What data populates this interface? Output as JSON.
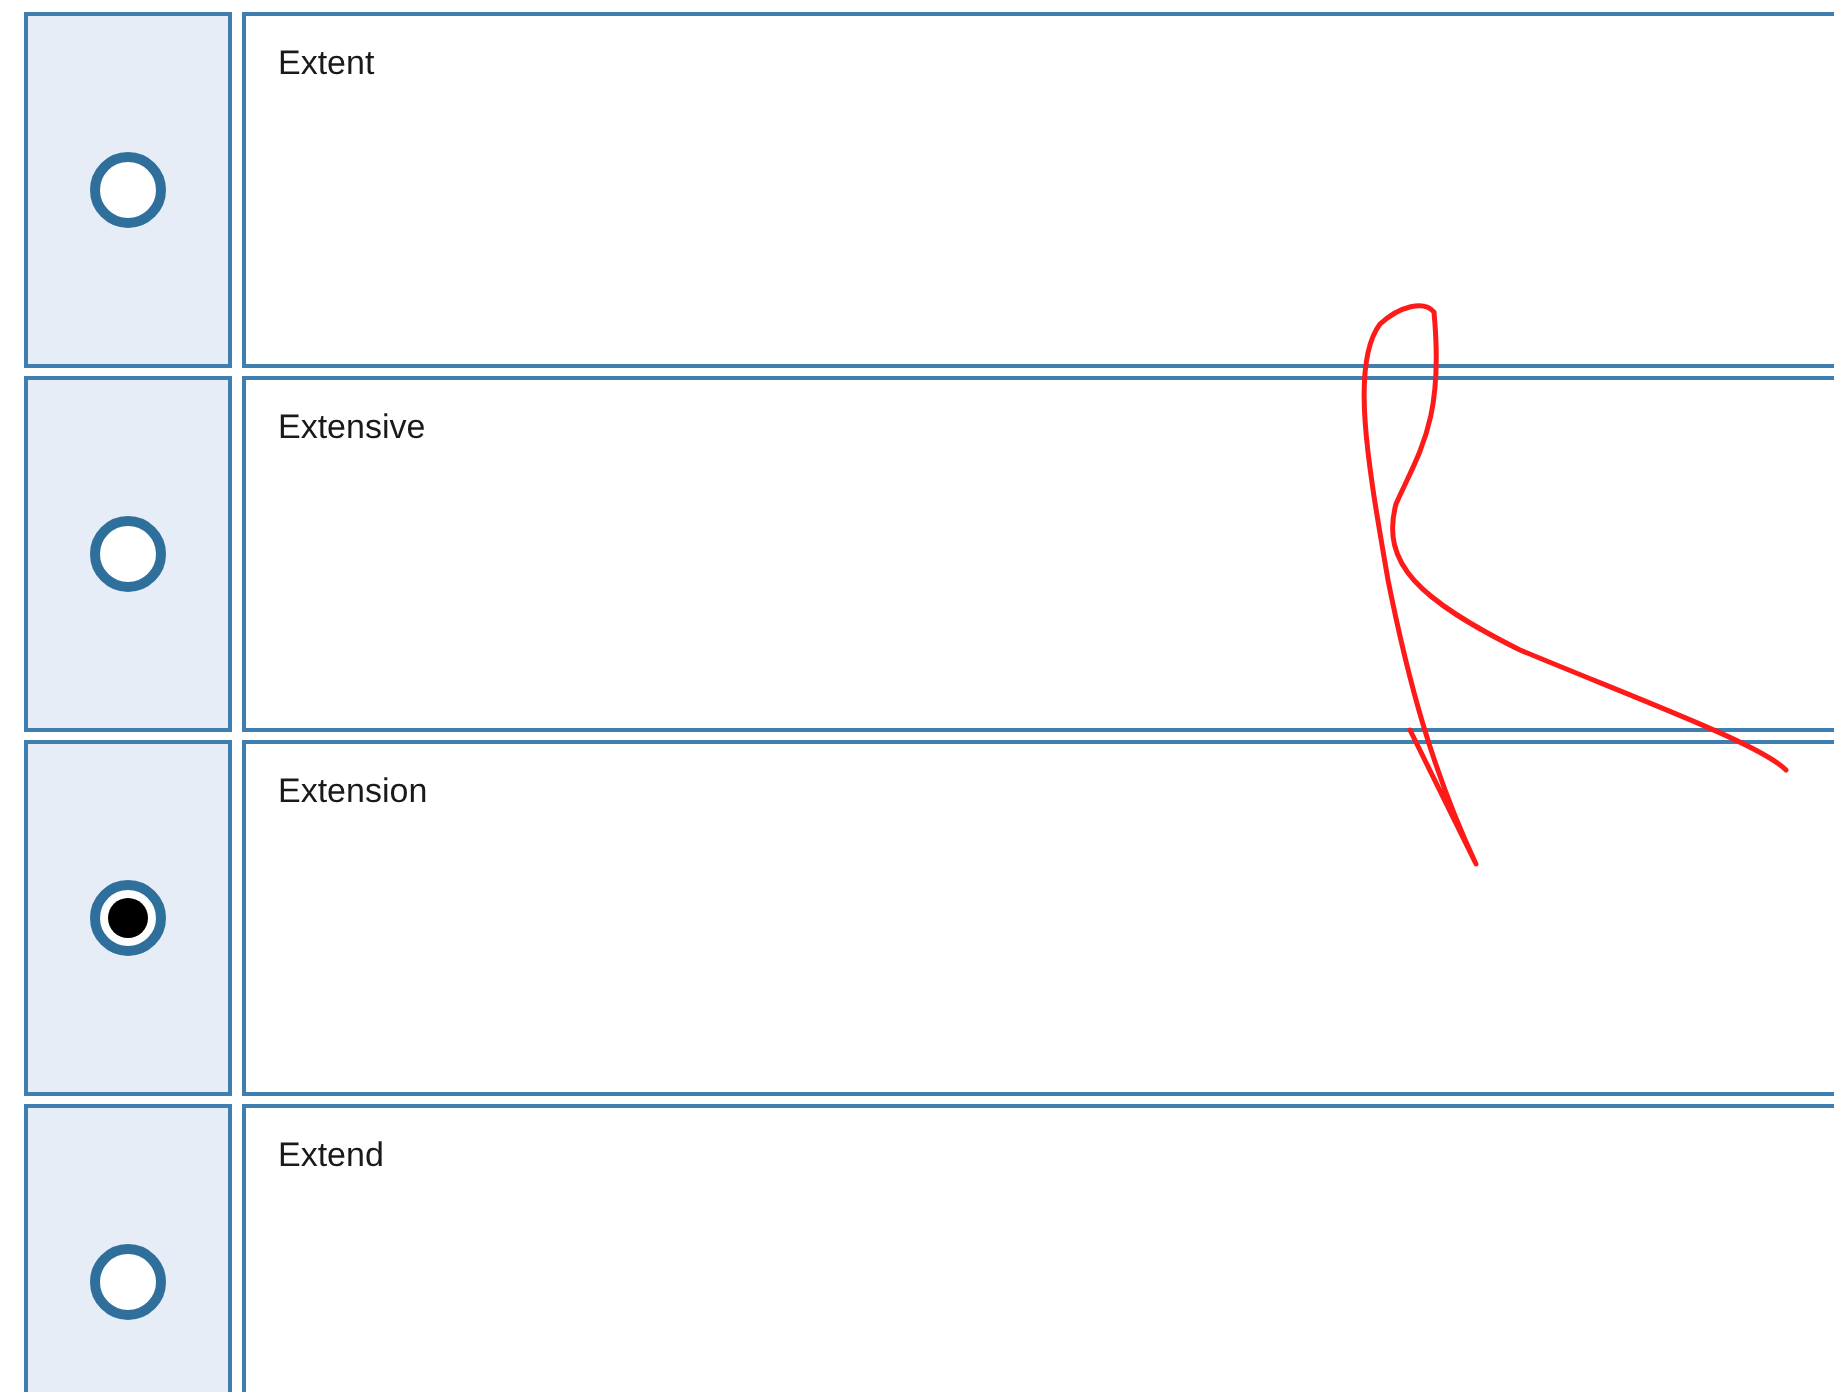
{
  "options": [
    {
      "label": "Extent",
      "selected": false
    },
    {
      "label": "Extensive",
      "selected": false
    },
    {
      "label": "Extension",
      "selected": true
    },
    {
      "label": "Extend",
      "selected": false
    }
  ]
}
